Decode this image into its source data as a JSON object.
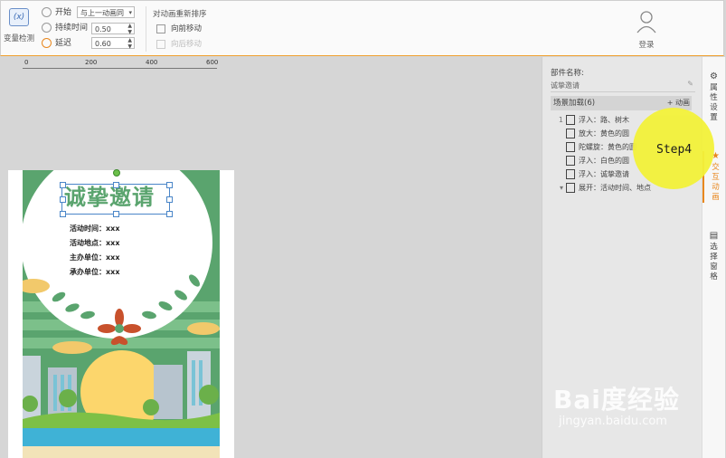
{
  "toolbar": {
    "variable_detect": "变量检测",
    "start_label": "开始",
    "start_value": "与上一动画同",
    "duration_label": "持续时间",
    "duration_value": "0.50",
    "delay_label": "延迟",
    "delay_value": "0.60",
    "reorder_title": "对动画重新排序",
    "move_forward": "向前移动",
    "move_backward": "向后移动",
    "login": "登录"
  },
  "ruler": {
    "ticks": [
      "0",
      "200",
      "400",
      "600"
    ]
  },
  "poster": {
    "title": "诚挚邀请",
    "lines": [
      "活动时间：xxx",
      "活动地点：xxx",
      "主办单位：xxx",
      "承办单位：xxx"
    ]
  },
  "panel": {
    "component_name_label": "部件名称:",
    "component_name_value": "诚挚邀请",
    "scene_label": "场景加载(6)",
    "add_animation": "+ 动画",
    "animations": [
      {
        "num": "1",
        "text": "浮入：路、树木"
      },
      {
        "num": "",
        "text": "放大：黄色的圆"
      },
      {
        "num": "",
        "text": "陀螺旋：黄色的圆"
      },
      {
        "num": "",
        "text": "浮入：白色的圆"
      },
      {
        "num": "",
        "text": "浮入：诚挚邀请"
      },
      {
        "num": "▾",
        "text": "展开：活动时间、地点"
      }
    ]
  },
  "side_tabs": {
    "properties": "属性设置",
    "interaction": "交互动画",
    "select_pane": "选择窗格"
  },
  "step_label": "Step4",
  "watermark": {
    "brand": "Bai度经验",
    "url": "jingyan.baidu.com"
  },
  "colors": {
    "accent": "#e8871e",
    "highlight": "#f3f23a",
    "poster_green": "#5aa46e"
  }
}
